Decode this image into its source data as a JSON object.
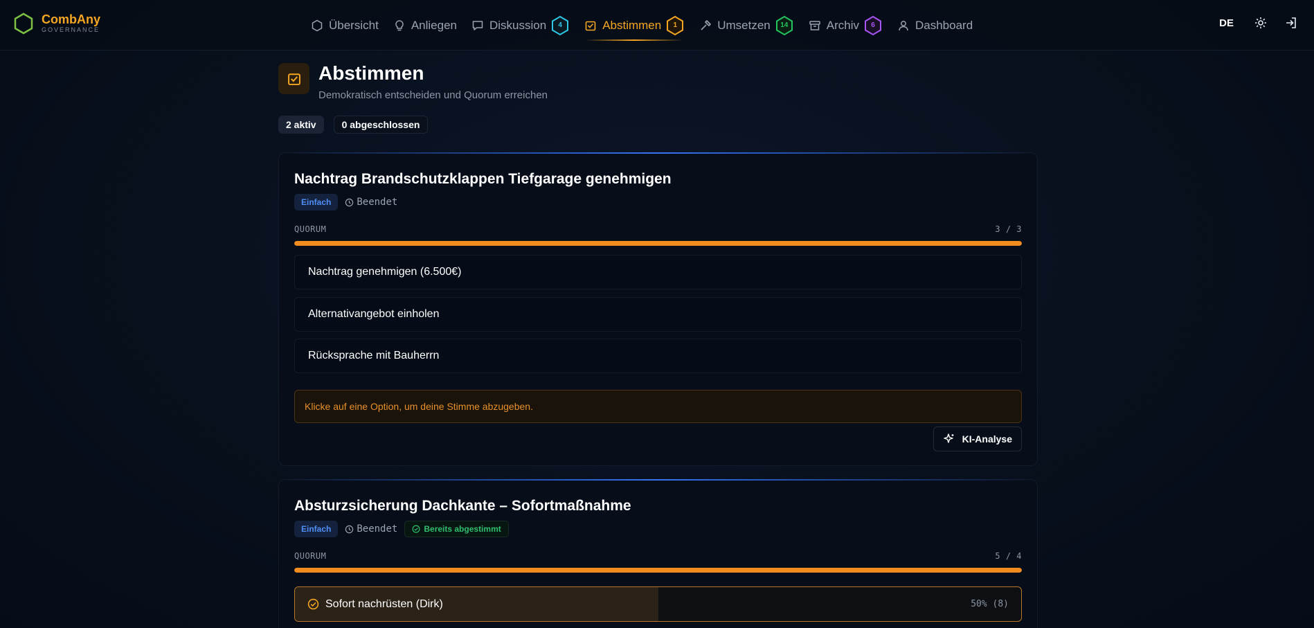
{
  "brand": {
    "name": "CombAny",
    "subtitle": "GOVERNANCE"
  },
  "nav": [
    {
      "label": "Übersicht",
      "icon": "hexagon-icon"
    },
    {
      "label": "Anliegen",
      "icon": "lightbulb-icon"
    },
    {
      "label": "Diskussion",
      "icon": "chat-icon",
      "count": "4",
      "color": "#2ec8e6"
    },
    {
      "label": "Abstimmen",
      "icon": "vote-box-icon",
      "count": "1",
      "color": "#f5a623",
      "active": true
    },
    {
      "label": "Umsetzen",
      "icon": "hammer-icon",
      "count": "14",
      "color": "#22c55e"
    },
    {
      "label": "Archiv",
      "icon": "archive-icon",
      "count": "6",
      "color": "#a855f7"
    },
    {
      "label": "Dashboard",
      "icon": "user-icon"
    }
  ],
  "header_right": {
    "language": "DE",
    "settings_icon": "gear-icon",
    "login_icon": "login-icon"
  },
  "page": {
    "title": "Abstimmen",
    "subtitle": "Demokratisch entscheiden und Quorum erreichen",
    "stats": {
      "active": "2 aktiv",
      "closed": "0 abgeschlossen"
    }
  },
  "votes": [
    {
      "title": "Nachtrag Brandschutzklappen Tiefgarage genehmigen",
      "type": "Einfach",
      "status": "Beendet",
      "quorum_label": "QUORUM",
      "quorum_text": "3 / 3",
      "quorum_fraction": 1.0,
      "options": [
        "Nachtrag genehmigen (6.500€)",
        "Alternativangebot einholen",
        "Rücksprache mit Bauherrn"
      ],
      "hint": "Klicke auf eine Option, um deine Stimme abzugeben.",
      "ai_button": "KI-Analyse"
    },
    {
      "title": "Absturzsicherung Dachkante – Sofortmaßnahme",
      "type": "Einfach",
      "status": "Beendet",
      "voted_badge": "Bereits abgestimmt",
      "quorum_label": "QUORUM",
      "quorum_text": "5 / 4",
      "quorum_fraction": 1.0,
      "result_option": {
        "label": "Sofort nachrüsten (Dirk)",
        "result": "50% (8)",
        "fraction": 0.5
      }
    }
  ],
  "colors": {
    "accent": "#f5a623",
    "quorum": "#f28c1e",
    "type_chip": "#4f8ef7",
    "voted": "#2fbf6f",
    "brand_hex": "#7bc043"
  }
}
